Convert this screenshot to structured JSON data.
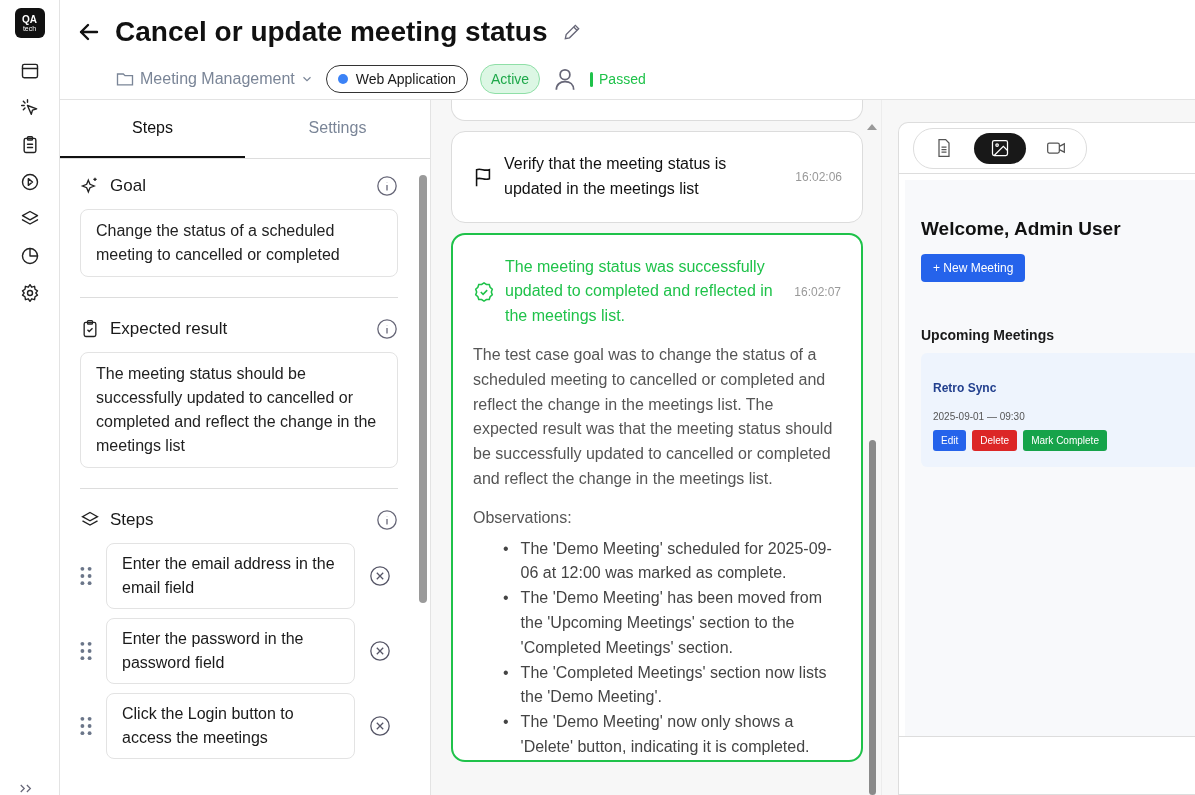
{
  "logo": {
    "line1": "QA",
    "line2": "tech"
  },
  "header": {
    "title": "Cancel or update meeting status",
    "project": "Meeting Management",
    "app": "Web Application",
    "status": "Active",
    "result": "Passed"
  },
  "tabs": [
    {
      "label": "Steps",
      "selected": true
    },
    {
      "label": "Settings",
      "selected": false
    }
  ],
  "goal": {
    "title": "Goal",
    "text": "Change the status of a scheduled meeting to cancelled or completed"
  },
  "expected": {
    "title": "Expected result",
    "text": "The meeting status should be successfully updated to cancelled or completed and reflect the change in the meetings list"
  },
  "steps": {
    "title": "Steps",
    "items": [
      "Enter the email address in the email field",
      "Enter the password in the password field",
      "Click the Login button to access the meetings"
    ]
  },
  "log": [
    {
      "kind": "step",
      "text": "Verify that the meeting status is updated in the meetings list",
      "time": "16:02:06"
    },
    {
      "kind": "result",
      "text": "The meeting status was successfully updated to completed and reflected in the meetings list.",
      "time": "16:02:07",
      "summary": "The test case goal was to change the status of a scheduled meeting to cancelled or completed and reflect the change in the meetings list. The expected result was that the meeting status should be successfully updated to cancelled or completed and reflect the change in the meetings list.",
      "observations_title": "Observations:",
      "bullet": "•",
      "observations": [
        "The 'Demo Meeting' scheduled for 2025-09-06 at 12:00 was marked as complete.",
        "The 'Demo Meeting' has been moved from the 'Upcoming Meetings' section to the 'Completed Meetings' section.",
        "The 'Completed Meetings' section now lists the 'Demo Meeting'.",
        "The 'Demo Meeting' now only shows a 'Delete' button, indicating it is completed."
      ]
    }
  ],
  "preview": {
    "tabs": [
      {
        "kind": "document",
        "selected": false
      },
      {
        "kind": "image",
        "selected": true
      },
      {
        "kind": "video",
        "selected": false
      }
    ],
    "heading": "Welcome, Admin User",
    "new_button": "+ New Meeting",
    "section": "Upcoming Meetings",
    "meeting": {
      "title": "Retro Sync",
      "datetime": "2025-09-01 — 09:30",
      "actions": [
        {
          "label": "Edit",
          "color": "#2563eb"
        },
        {
          "label": "Delete",
          "color": "#dc2626"
        },
        {
          "label": "Mark Complete",
          "color": "#16a34a"
        }
      ]
    }
  }
}
